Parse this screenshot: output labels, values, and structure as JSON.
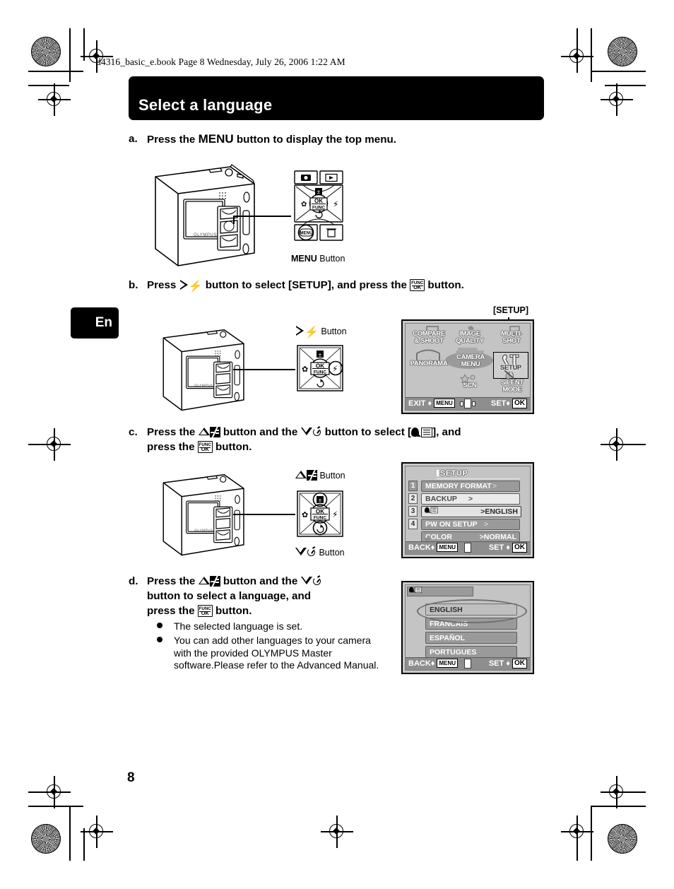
{
  "page": {
    "book_header": "d4316_basic_e.book  Page 8  Wednesday, July 26, 2006  1:22 AM",
    "title": "Select a language",
    "lang_tab": "En",
    "page_number": "8"
  },
  "steps": {
    "a": {
      "letter": "a.",
      "text_before": "Press the ",
      "menu_word": "MENU",
      "text_after": " button to display the top menu."
    },
    "b": {
      "letter": "b.",
      "t1": "Press ",
      "t2": " button to select [SETUP], and press the ",
      "t3": " button."
    },
    "c": {
      "letter": "c.",
      "t1": "Press the ",
      "t2": " button and the ",
      "t3": " button to select [",
      "t4": "], and",
      "line2a": "press the ",
      "line2b": " button."
    },
    "d": {
      "letter": "d.",
      "t1": "Press the ",
      "t2": "  button and the ",
      "t3": "",
      "line2": "button to select  a language, and",
      "line3a": "press the ",
      "line3b": " button."
    }
  },
  "bullets": [
    "The selected language is set.",
    "You can add other languages to your camera with the provided OLYMPUS Master software.Please refer to the Advanced Manual."
  ],
  "callouts": {
    "menu_button": {
      "bold": "MENU",
      "normal": " Button"
    },
    "right_flash_button": " Button",
    "up_ev_button": " Button",
    "down_timer_button": " Button",
    "setup_tag": "[SETUP]"
  },
  "dpad": {
    "ok_line1": "OK",
    "ok_line2": "FUNC"
  },
  "top_menu_screen": {
    "items": [
      "COMPARE\n& SHOOT",
      "IMAGE\nQUALITY",
      "MULTI-\nSHOT",
      "PANORAMA",
      "CAMERA\nMENU",
      "SETUP",
      "SCN",
      "SILENT\nMODE"
    ],
    "selected": "SETUP",
    "bottom_left": "EXIT",
    "bottom_left_key": "MENU",
    "bottom_right": "SET",
    "bottom_right_key": "OK",
    "diamond": "♦"
  },
  "setup_menu_screen": {
    "title": "SETUP",
    "numbers": [
      "1",
      "2",
      "3",
      "4"
    ],
    "rows": [
      {
        "label": "MEMORY FORMAT",
        "value": ">",
        "style": "dark"
      },
      {
        "label": "BACKUP",
        "value": ">",
        "style": "light"
      },
      {
        "label": "",
        "value": ">ENGLISH",
        "style": "sel",
        "icon": "language-icon"
      },
      {
        "label": "PW ON SETUP",
        "value": ">",
        "style": "dark"
      },
      {
        "label": "COLOR",
        "value": ">NORMAL",
        "style": "dark"
      }
    ],
    "bottom_left": "BACK",
    "bottom_left_key": "MENU",
    "bottom_right": "SET",
    "bottom_right_key": "OK",
    "diamond": "♦"
  },
  "language_screen": {
    "options": [
      "ENGLISH",
      "FRANCAIS",
      "ESPAÑOL",
      "PORTUGUES"
    ],
    "selected": "ENGLISH",
    "bottom_left": "BACK",
    "bottom_left_key": "MENU",
    "bottom_right": "SET",
    "bottom_right_key": "OK",
    "diamond": "♦"
  },
  "colors": {
    "ink": "#000000",
    "lcd_bg": "#c2c2c2",
    "lcd_bar": "#8e8e8e",
    "row_dark": "#9a9a9a",
    "row_light": "#eaeaea"
  }
}
